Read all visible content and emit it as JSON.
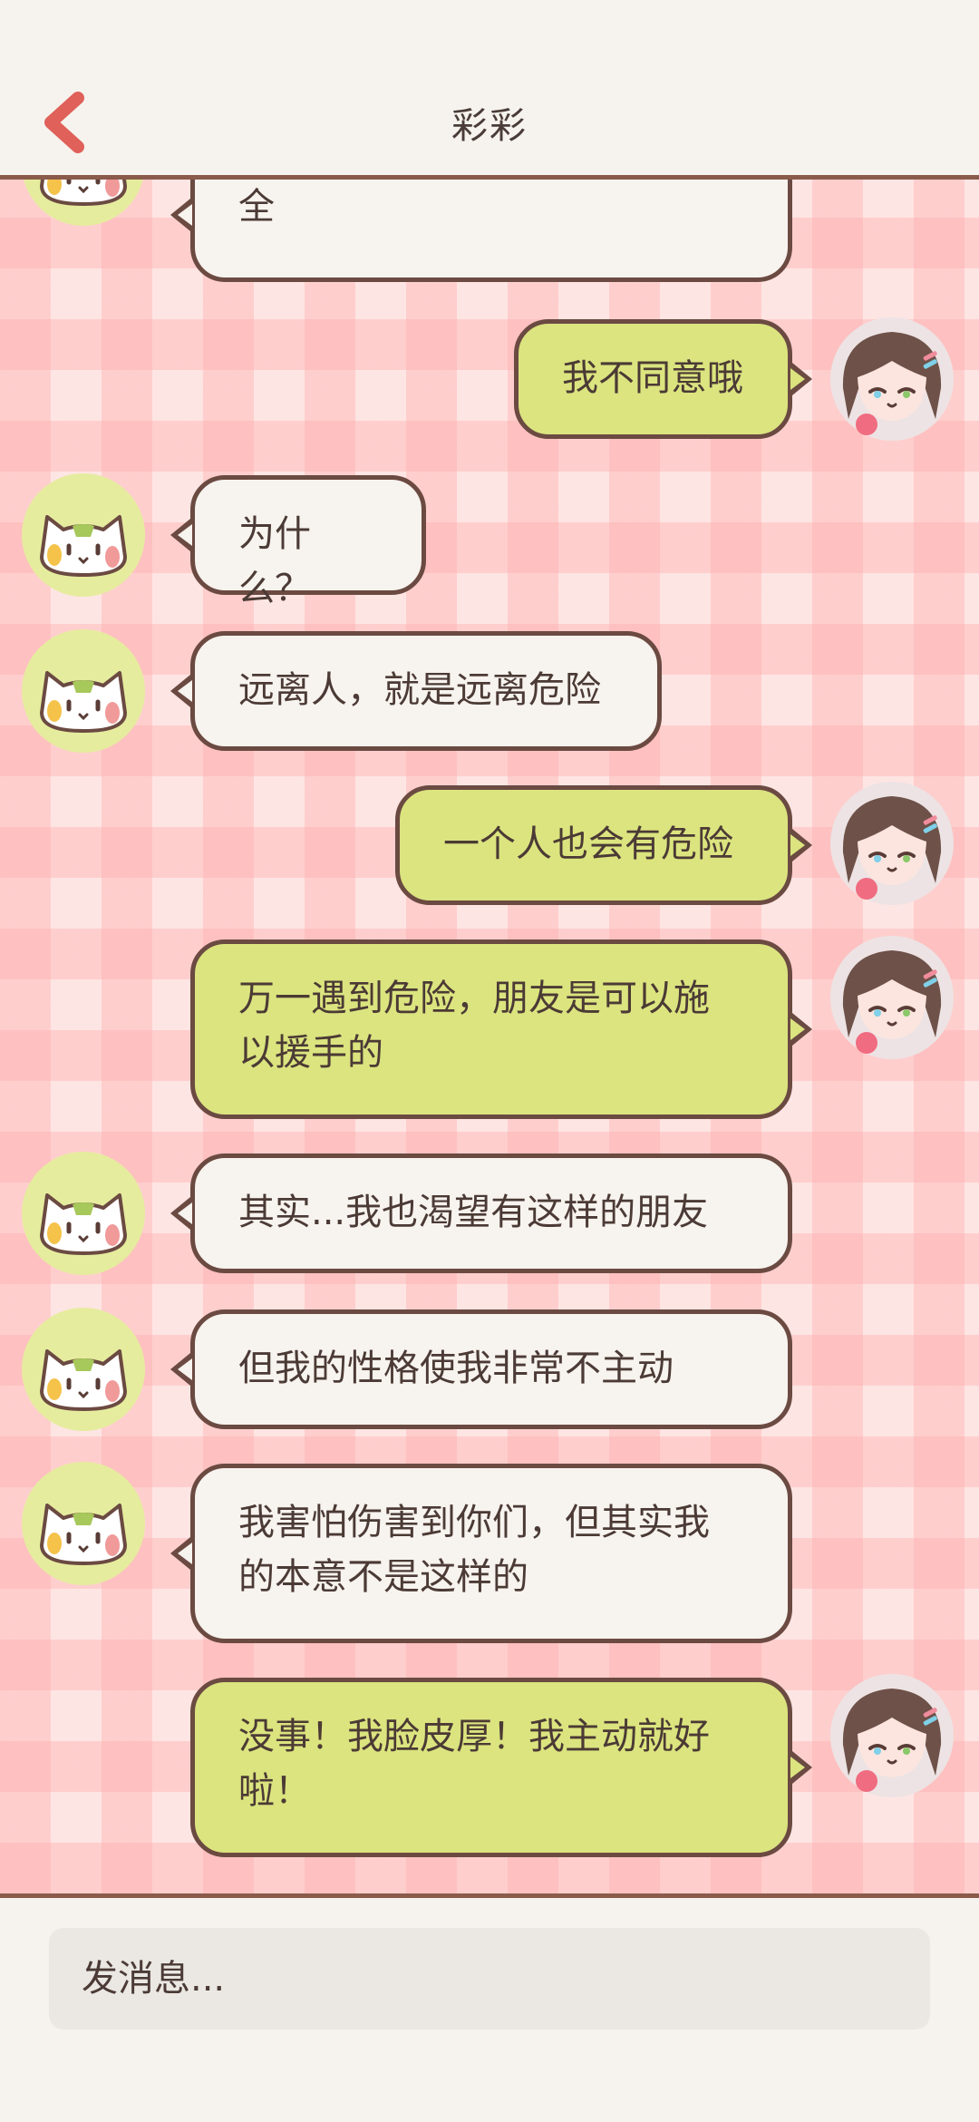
{
  "header": {
    "title": "彩彩"
  },
  "messages": [
    {
      "side": "in",
      "text": "全"
    },
    {
      "side": "out",
      "text": "我不同意哦"
    },
    {
      "side": "in",
      "text": "为什么？"
    },
    {
      "side": "in",
      "text": "远离人，就是远离危险"
    },
    {
      "side": "out",
      "text": "一个人也会有危险"
    },
    {
      "side": "out",
      "text": "万一遇到危险，朋友是可以施以援手的"
    },
    {
      "side": "in",
      "text": "其实...我也渴望有这样的朋友"
    },
    {
      "side": "in",
      "text": "但我的性格使我非常不主动"
    },
    {
      "side": "in",
      "text": "我害怕伤害到你们，但其实我的本意不是这样的"
    },
    {
      "side": "out",
      "text": "没事！我脸皮厚！我主动就好啦！"
    }
  ],
  "composer": {
    "placeholder": "发消息..."
  },
  "icons": {
    "back": "chevron-left-icon",
    "cat": "cat-avatar-icon",
    "girl": "girl-avatar-icon"
  },
  "colors": {
    "accent": "#e0605a",
    "bubble_out": "#dbe47f",
    "bubble_in": "#f7f3ee",
    "border": "#6b4a42"
  }
}
